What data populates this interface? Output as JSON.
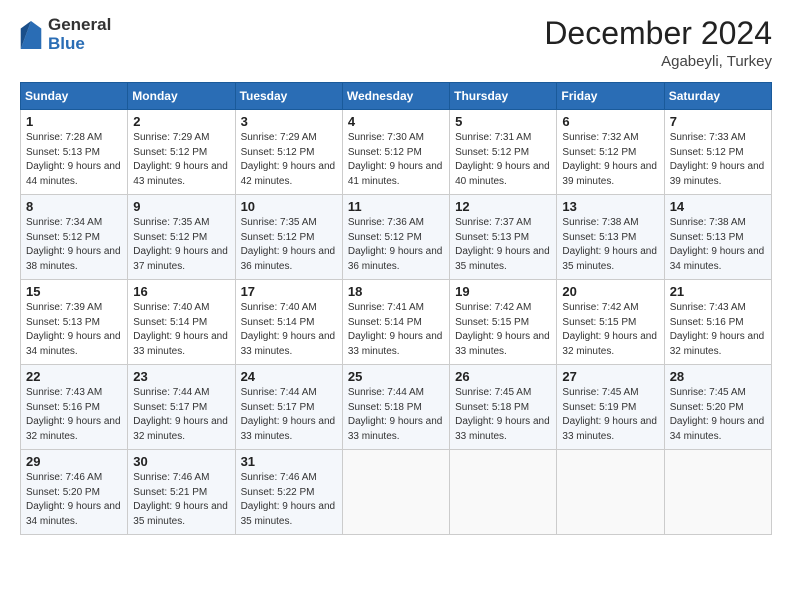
{
  "logo": {
    "general": "General",
    "blue": "Blue"
  },
  "title": "December 2024",
  "location": "Agabeyli, Turkey",
  "weekdays": [
    "Sunday",
    "Monday",
    "Tuesday",
    "Wednesday",
    "Thursday",
    "Friday",
    "Saturday"
  ],
  "weeks": [
    [
      {
        "day": "1",
        "sunrise": "7:28 AM",
        "sunset": "5:13 PM",
        "daylight": "9 hours and 44 minutes."
      },
      {
        "day": "2",
        "sunrise": "7:29 AM",
        "sunset": "5:12 PM",
        "daylight": "9 hours and 43 minutes."
      },
      {
        "day": "3",
        "sunrise": "7:29 AM",
        "sunset": "5:12 PM",
        "daylight": "9 hours and 42 minutes."
      },
      {
        "day": "4",
        "sunrise": "7:30 AM",
        "sunset": "5:12 PM",
        "daylight": "9 hours and 41 minutes."
      },
      {
        "day": "5",
        "sunrise": "7:31 AM",
        "sunset": "5:12 PM",
        "daylight": "9 hours and 40 minutes."
      },
      {
        "day": "6",
        "sunrise": "7:32 AM",
        "sunset": "5:12 PM",
        "daylight": "9 hours and 39 minutes."
      },
      {
        "day": "7",
        "sunrise": "7:33 AM",
        "sunset": "5:12 PM",
        "daylight": "9 hours and 39 minutes."
      }
    ],
    [
      {
        "day": "8",
        "sunrise": "7:34 AM",
        "sunset": "5:12 PM",
        "daylight": "9 hours and 38 minutes."
      },
      {
        "day": "9",
        "sunrise": "7:35 AM",
        "sunset": "5:12 PM",
        "daylight": "9 hours and 37 minutes."
      },
      {
        "day": "10",
        "sunrise": "7:35 AM",
        "sunset": "5:12 PM",
        "daylight": "9 hours and 36 minutes."
      },
      {
        "day": "11",
        "sunrise": "7:36 AM",
        "sunset": "5:12 PM",
        "daylight": "9 hours and 36 minutes."
      },
      {
        "day": "12",
        "sunrise": "7:37 AM",
        "sunset": "5:13 PM",
        "daylight": "9 hours and 35 minutes."
      },
      {
        "day": "13",
        "sunrise": "7:38 AM",
        "sunset": "5:13 PM",
        "daylight": "9 hours and 35 minutes."
      },
      {
        "day": "14",
        "sunrise": "7:38 AM",
        "sunset": "5:13 PM",
        "daylight": "9 hours and 34 minutes."
      }
    ],
    [
      {
        "day": "15",
        "sunrise": "7:39 AM",
        "sunset": "5:13 PM",
        "daylight": "9 hours and 34 minutes."
      },
      {
        "day": "16",
        "sunrise": "7:40 AM",
        "sunset": "5:14 PM",
        "daylight": "9 hours and 33 minutes."
      },
      {
        "day": "17",
        "sunrise": "7:40 AM",
        "sunset": "5:14 PM",
        "daylight": "9 hours and 33 minutes."
      },
      {
        "day": "18",
        "sunrise": "7:41 AM",
        "sunset": "5:14 PM",
        "daylight": "9 hours and 33 minutes."
      },
      {
        "day": "19",
        "sunrise": "7:42 AM",
        "sunset": "5:15 PM",
        "daylight": "9 hours and 33 minutes."
      },
      {
        "day": "20",
        "sunrise": "7:42 AM",
        "sunset": "5:15 PM",
        "daylight": "9 hours and 32 minutes."
      },
      {
        "day": "21",
        "sunrise": "7:43 AM",
        "sunset": "5:16 PM",
        "daylight": "9 hours and 32 minutes."
      }
    ],
    [
      {
        "day": "22",
        "sunrise": "7:43 AM",
        "sunset": "5:16 PM",
        "daylight": "9 hours and 32 minutes."
      },
      {
        "day": "23",
        "sunrise": "7:44 AM",
        "sunset": "5:17 PM",
        "daylight": "9 hours and 32 minutes."
      },
      {
        "day": "24",
        "sunrise": "7:44 AM",
        "sunset": "5:17 PM",
        "daylight": "9 hours and 33 minutes."
      },
      {
        "day": "25",
        "sunrise": "7:44 AM",
        "sunset": "5:18 PM",
        "daylight": "9 hours and 33 minutes."
      },
      {
        "day": "26",
        "sunrise": "7:45 AM",
        "sunset": "5:18 PM",
        "daylight": "9 hours and 33 minutes."
      },
      {
        "day": "27",
        "sunrise": "7:45 AM",
        "sunset": "5:19 PM",
        "daylight": "9 hours and 33 minutes."
      },
      {
        "day": "28",
        "sunrise": "7:45 AM",
        "sunset": "5:20 PM",
        "daylight": "9 hours and 34 minutes."
      }
    ],
    [
      {
        "day": "29",
        "sunrise": "7:46 AM",
        "sunset": "5:20 PM",
        "daylight": "9 hours and 34 minutes."
      },
      {
        "day": "30",
        "sunrise": "7:46 AM",
        "sunset": "5:21 PM",
        "daylight": "9 hours and 35 minutes."
      },
      {
        "day": "31",
        "sunrise": "7:46 AM",
        "sunset": "5:22 PM",
        "daylight": "9 hours and 35 minutes."
      },
      null,
      null,
      null,
      null
    ]
  ],
  "labels": {
    "sunrise": "Sunrise:",
    "sunset": "Sunset:",
    "daylight": "Daylight:"
  }
}
